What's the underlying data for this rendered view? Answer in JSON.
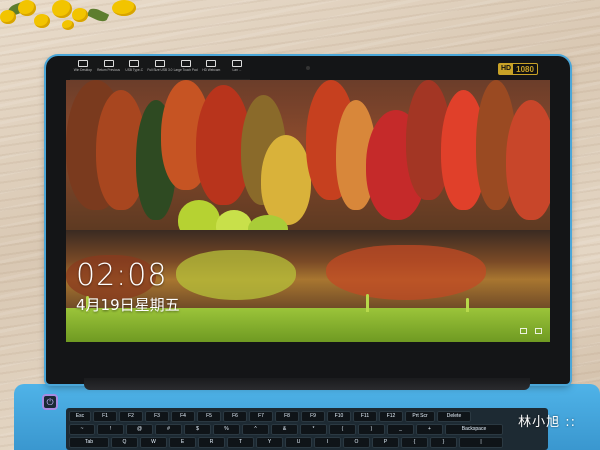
{
  "toolbar": {
    "items": [
      {
        "label": "Win Desktop",
        "icon": "desktop-icon"
      },
      {
        "label": "Return Previous",
        "icon": "return-icon"
      },
      {
        "label": "USB Type-C",
        "icon": "usb-c-icon"
      },
      {
        "label": "Full Size USB 3.0",
        "icon": "usb-icon"
      },
      {
        "label": "Large Touch Pad",
        "icon": "touchpad-icon"
      },
      {
        "label": "HD Webcam",
        "icon": "webcam-icon"
      },
      {
        "label": "Lan ...",
        "icon": "lan-icon"
      }
    ]
  },
  "badge": {
    "hd": "HD",
    "resolution": "1080"
  },
  "lockscreen": {
    "time": "02:08",
    "date": "4月19日星期五"
  },
  "keyboard": {
    "row1": [
      "Esc",
      "F1",
      "F2",
      "F3",
      "F4",
      "F5",
      "F6",
      "F7",
      "F8",
      "F9",
      "F10",
      "F11",
      "F12",
      "Prt Scr",
      "Delete"
    ],
    "row2": [
      "~",
      "!",
      "@",
      "#",
      "$",
      "%",
      "^",
      "&",
      "*",
      "(",
      ")",
      "_",
      "+",
      "Backspace"
    ],
    "row3": [
      "Tab",
      "Q",
      "W",
      "E",
      "R",
      "T",
      "Y",
      "U",
      "I",
      "O",
      "P",
      "{",
      "}",
      "|"
    ]
  },
  "watermark": "林小旭 ::",
  "colors": {
    "laptop_body": "#4aa6d8",
    "bezel": "#141517",
    "badge_gold": "#c9a227"
  }
}
